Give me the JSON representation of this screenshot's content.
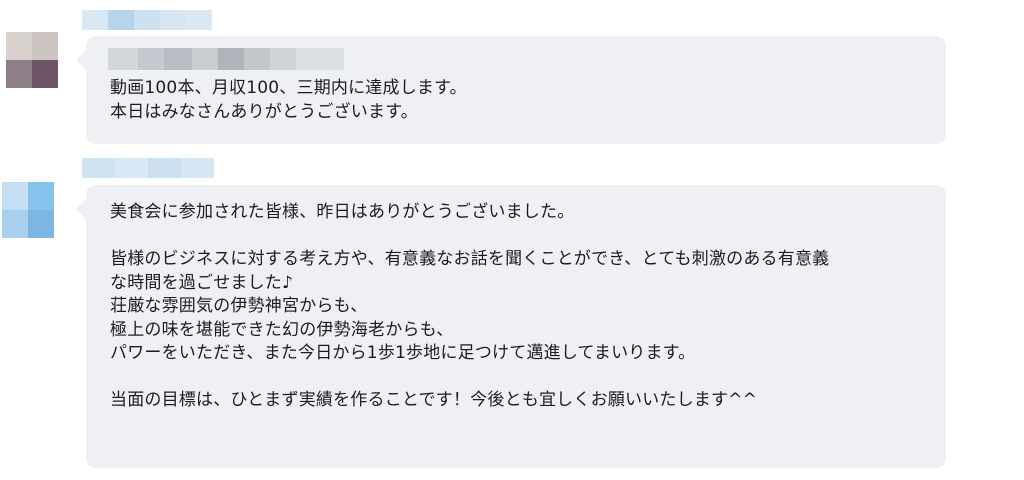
{
  "messages": [
    {
      "body": "動画100本、月収100、三期内に達成します。\n本日はみなさんありがとうございます。"
    },
    {
      "body": "美食会に参加された皆様、昨日はありがとうございました。\n\n皆様のビジネスに対する考え方や、有意義なお話を聞くことができ、とても刺激のある有意義\nな時間を過ごせました♪\n荘厳な雰囲気の伊勢神宮からも、\n極上の味を堪能できた幻の伊勢海老からも、\nパワーをいただき、また今日から1歩1歩地に足つけて邁進してまいります。\n\n当面の目標は、ひとまず実績を作ることです！今後とも宜しくお願いいたします^^"
    }
  ],
  "colors": {
    "bubble_bg": "#eef0f4",
    "text": "#1d1c1d"
  },
  "icons": {
    "avatar_1": "blurred-avatar",
    "avatar_2": "blurred-avatar"
  }
}
